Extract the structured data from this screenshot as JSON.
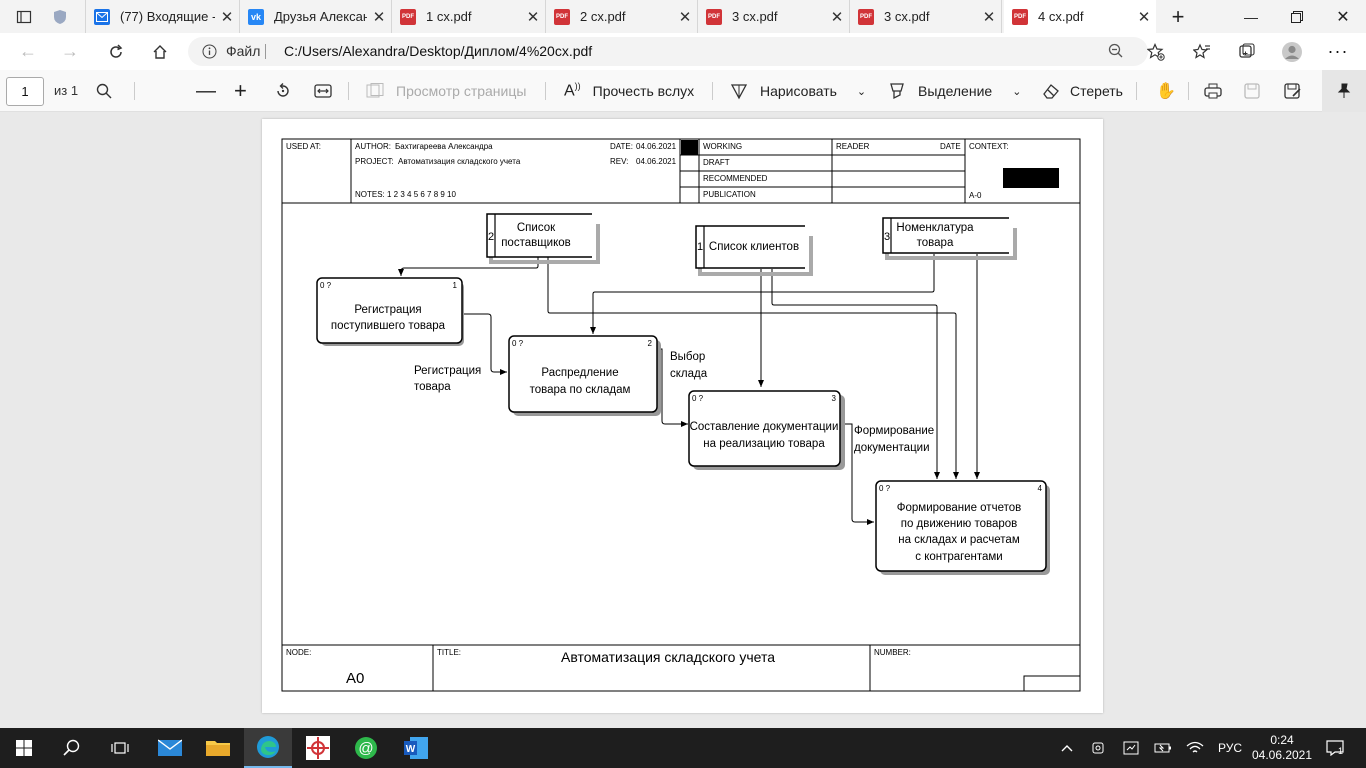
{
  "tabs": [
    {
      "title": "",
      "icon": "shield-icon",
      "active": false
    },
    {
      "title": "(77) Входящие -",
      "icon": "mail-icon",
      "active": false
    },
    {
      "title": "Друзья Александ",
      "icon": "vk-icon",
      "active": false
    },
    {
      "title": "1 сх.pdf",
      "icon": "pdf-icon",
      "active": false
    },
    {
      "title": "2 сх.pdf",
      "icon": "pdf-icon",
      "active": false
    },
    {
      "title": "3 сх.pdf",
      "icon": "pdf-icon",
      "active": false
    },
    {
      "title": "3 сх.pdf",
      "icon": "pdf-icon",
      "active": false
    },
    {
      "title": "4 сх.pdf",
      "icon": "pdf-icon",
      "active": true
    }
  ],
  "address": {
    "scheme_label": "Файл",
    "url": "C:/Users/Alexandra/Desktop/Диплом/4%20сх.pdf"
  },
  "pdf_toolbar": {
    "page_number": "1",
    "page_total": "из 1",
    "page_view": "Просмотр страницы",
    "read_aloud": "Прочесть вслух",
    "draw": "Нарисовать",
    "highlight": "Выделение",
    "erase": "Стереть"
  },
  "diagram": {
    "header": {
      "used_at": "USED AT:",
      "author_label": "AUTHOR:",
      "author": "Бахтигареева Александра",
      "project_label": "PROJECT:",
      "project": "Автоматизация складского учета",
      "notes": "NOTES:  1  2  3  4  5  6  7  8  9  10",
      "date_label": "DATE:",
      "date": "04.06.2021",
      "rev_label": "REV:",
      "rev": "04.06.2021",
      "working": "WORKING",
      "draft": "DRAFT",
      "recommended": "RECOMMENDED",
      "publication": "PUBLICATION",
      "reader": "READER",
      "reader_date": "DATE",
      "context": "CONTEXT:",
      "context_node": "A-0"
    },
    "datastores": [
      {
        "num": "2",
        "line1": "Список",
        "line2": "поставщиков"
      },
      {
        "num": "1",
        "line1": "Список клиентов",
        "line2": ""
      },
      {
        "num": "3",
        "line1": "Номенклатура",
        "line2": "товара"
      }
    ],
    "boxes": [
      {
        "num": "1",
        "line1": "Регистрация",
        "line2": "поступившего товара",
        "line3": "",
        "line4": ""
      },
      {
        "num": "2",
        "line1": "Распредление",
        "line2": "товара по складам",
        "line3": "",
        "line4": ""
      },
      {
        "num": "3",
        "line1": "Составление документации",
        "line2": "на реализацию товара",
        "line3": "",
        "line4": ""
      },
      {
        "num": "4",
        "line1": "Формирование отчетов",
        "line2": "по движению товаров",
        "line3": "на складах и расчетам",
        "line4": "с контрагентами"
      }
    ],
    "box_tag": "0 ?",
    "arrow_labels": [
      {
        "line1": "Регистрация",
        "line2": "товара"
      },
      {
        "line1": "Выбор",
        "line2": "склада"
      },
      {
        "line1": "Формирование",
        "line2": "документации"
      }
    ],
    "footer": {
      "node_label": "NODE:",
      "node": "A0",
      "title_label": "TITLE:",
      "title": "Автоматизация складского учета",
      "number_label": "NUMBER:"
    }
  },
  "taskbar": {
    "language": "РУС",
    "time": "0:24",
    "date": "04.06.2021",
    "notifications": "1"
  }
}
